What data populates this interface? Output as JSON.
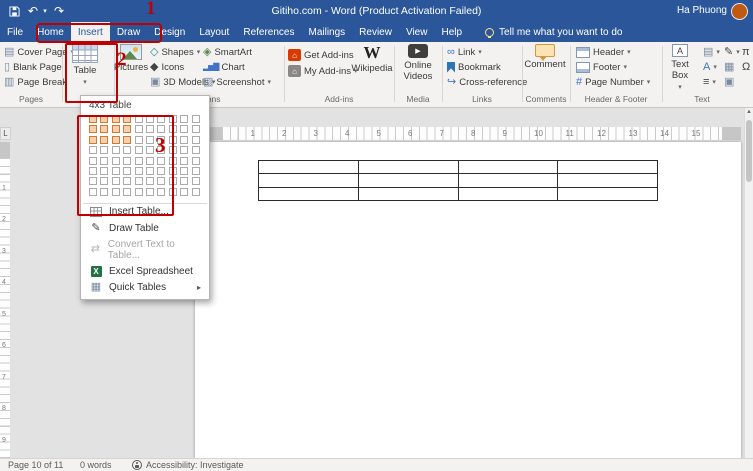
{
  "titlebar": {
    "title": "Gitiho.com - Word (Product Activation Failed)",
    "user": "Ha Phuong"
  },
  "tabs": [
    {
      "label": "File"
    },
    {
      "label": "Home"
    },
    {
      "label": "Insert"
    },
    {
      "label": "Draw"
    },
    {
      "label": "Design"
    },
    {
      "label": "Layout"
    },
    {
      "label": "References"
    },
    {
      "label": "Mailings"
    },
    {
      "label": "Review"
    },
    {
      "label": "View"
    },
    {
      "label": "Help"
    }
  ],
  "tell_me": "Tell me what you want to do",
  "ribbon": {
    "pages": {
      "label": "Pages",
      "items": [
        "Cover Page",
        "Blank Page",
        "Page Break"
      ]
    },
    "tables": {
      "button": "Table"
    },
    "illustrations": {
      "label": "Illustrations",
      "pictures": "Pictures",
      "col1": [
        "Shapes",
        "Icons",
        "3D Models"
      ],
      "col2": [
        "SmartArt",
        "Chart",
        "Screenshot"
      ]
    },
    "addins": {
      "label": "Add-ins",
      "get_addins": "Get Add-ins",
      "my_addins": "My Add-ins",
      "wikipedia": "Wikipedia"
    },
    "media": {
      "label": "Media",
      "online_videos": "Online Videos"
    },
    "links": {
      "label": "Links",
      "items": [
        "Link",
        "Bookmark",
        "Cross-reference"
      ]
    },
    "comments": {
      "label": "Comments",
      "comment": "Comment"
    },
    "header_footer": {
      "label": "Header & Footer",
      "items": [
        "Header",
        "Footer",
        "Page Number"
      ]
    },
    "text": {
      "label": "Text",
      "text_box": "Text Box"
    }
  },
  "table_dropdown": {
    "header": "4x3 Table",
    "grid": {
      "cols": 10,
      "rows": 8,
      "selected_cols": 4,
      "selected_rows": 3
    },
    "items": [
      {
        "label": "Insert Table...",
        "disabled": false
      },
      {
        "label": "Draw Table",
        "disabled": false
      },
      {
        "label": "Convert Text to Table...",
        "disabled": true
      },
      {
        "label": "Excel Spreadsheet",
        "disabled": false
      },
      {
        "label": "Quick Tables",
        "disabled": false,
        "submenu": true
      }
    ]
  },
  "document": {
    "ruler": {
      "numbers": [
        1,
        2,
        3,
        4,
        5,
        6,
        7,
        8,
        9,
        10,
        11,
        12,
        13,
        14,
        15
      ],
      "v_numbers": [
        1,
        2,
        3,
        4,
        5,
        6,
        7,
        8,
        9
      ]
    },
    "table": {
      "rows": 3,
      "cols": 4
    }
  },
  "statusbar": {
    "page": "Page 10 of 11",
    "words": "0 words",
    "accessibility": "Accessibility: Investigate"
  },
  "annotations": {
    "step1": "1",
    "step2": "2",
    "step3": "3",
    "color": "#c00000"
  },
  "icons": {
    "chevron_down": "▾",
    "submenu_arrow": "▸",
    "undo": "↶",
    "redo": "↷",
    "scroll_up": "▲",
    "cover_page": "▤",
    "blank_page": "▯",
    "page_break": "▥",
    "shapes": "◇",
    "icons_btn": "◆",
    "models_3d": "▣",
    "smartart": "◈",
    "chart": "▂▅▇",
    "screenshot": "▨",
    "home": "⌂",
    "wikipedia_w": "W",
    "play": "▶",
    "link": "∞",
    "cross_reference": "↪",
    "page_number": "#",
    "text_box_a": "A",
    "quick_parts": "▤",
    "wordart": "A",
    "dropcap": "≡",
    "signature": "✎",
    "datetime": "▦",
    "object_icon": "▣",
    "equation": "π",
    "symbol": "Ω",
    "draw_table": "✎",
    "convert": "⇄",
    "excel_x": "X",
    "quick_tables": "▦",
    "tab_selector": "L"
  },
  "colors": {
    "titlebar": "#2b579a",
    "ribbon": "#f3f2f1",
    "grid_highlight": "#f9cfad",
    "annotation": "#c00000"
  }
}
